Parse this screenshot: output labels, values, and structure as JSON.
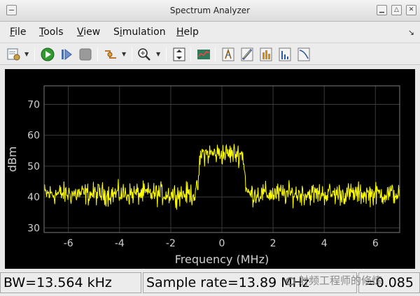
{
  "window": {
    "title": "Spectrum Analyzer"
  },
  "menu": [
    {
      "label": "File",
      "u": "F",
      "rest": "ile"
    },
    {
      "label": "Tools",
      "u": "T",
      "rest": "ools"
    },
    {
      "label": "View",
      "u": "V",
      "rest": "iew"
    },
    {
      "label": "Simulation",
      "pre": "S",
      "u": "i",
      "rest": "mulation"
    },
    {
      "label": "Help",
      "u": "H",
      "rest": "elp"
    }
  ],
  "toolbar": {
    "icons": [
      "settings-icon",
      "run-icon",
      "step-forward-icon",
      "stop-icon",
      "signal-select-icon",
      "zoom-in-icon",
      "autoscale-icon",
      "spectrum-type-icon",
      "cursor-measurements-icon",
      "peak-finder-icon",
      "channel-measurements-icon",
      "distortion-measurements-icon",
      "ccdf-icon"
    ]
  },
  "chart_data": {
    "type": "line",
    "xlabel": "Frequency (MHz)",
    "ylabel": "dBm",
    "xlim": [
      -6.95,
      6.95
    ],
    "ylim": [
      28.5,
      76
    ],
    "x_ticks": [
      "-6",
      "-4",
      "-2",
      "0",
      "2",
      "4",
      "6"
    ],
    "x_tick_values": [
      -6,
      -4,
      -2,
      0,
      2,
      4,
      6
    ],
    "y_ticks": [
      "30",
      "40",
      "50",
      "60",
      "70"
    ],
    "y_tick_values": [
      30,
      40,
      50,
      60,
      70
    ],
    "grid": true,
    "series": [
      {
        "color": "#ffff00",
        "x": [
          -6.95,
          -6.5,
          -6.0,
          -5.5,
          -5.0,
          -4.5,
          -4.0,
          -3.5,
          -3.0,
          -2.5,
          -2.0,
          -1.5,
          -1.2,
          -1.0,
          -0.95,
          -0.9,
          -0.85,
          -0.8,
          -0.5,
          0.0,
          0.5,
          0.8,
          0.85,
          0.9,
          0.95,
          1.0,
          1.5,
          2.0,
          2.5,
          3.0,
          3.5,
          4.0,
          4.5,
          5.0,
          5.5,
          6.0,
          6.5,
          6.95
        ],
        "values": [
          41,
          41,
          41,
          41,
          41,
          41,
          41,
          41,
          41,
          41,
          41,
          41,
          41,
          41,
          43,
          47,
          52,
          54,
          54,
          54,
          54,
          54,
          52,
          47,
          43,
          41,
          41,
          41,
          41,
          41,
          41,
          41,
          41,
          41,
          41,
          41,
          41,
          41
        ]
      }
    ]
  },
  "status": {
    "rbw": "BW=13.564 kHz",
    "sample_rate": "Sample rate=13.89 MHz",
    "extra": "=0.085"
  },
  "watermark": "射频工程师的修炼"
}
